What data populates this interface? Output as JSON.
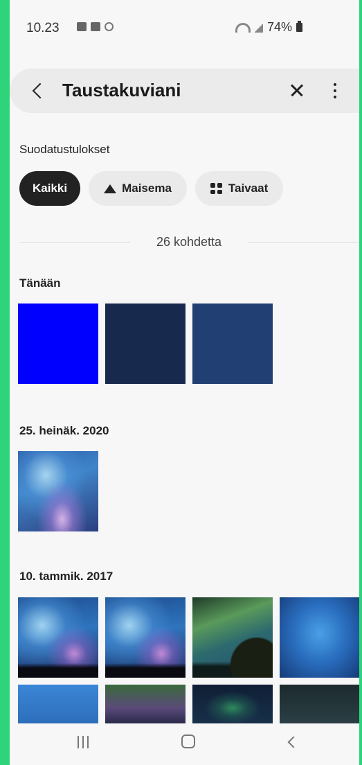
{
  "status_bar": {
    "time": "10.23",
    "battery": "74%"
  },
  "search": {
    "query": "Taustakuviani"
  },
  "filters": {
    "heading": "Suodatustulokset",
    "chips": [
      {
        "label": "Kaikki",
        "icon": ""
      },
      {
        "label": "Maisema",
        "icon": "landscape-icon"
      },
      {
        "label": "Taivaat",
        "icon": "grid-icon"
      }
    ]
  },
  "results_count": "26 kohdetta",
  "sections": [
    {
      "title": "Tänään",
      "thumbs": [
        "#0000ff",
        "#17294c",
        "#213f73"
      ]
    },
    {
      "title": "25. heinäk. 2020",
      "thumbs": [
        "aurora"
      ]
    },
    {
      "title": "10. tammik. 2017",
      "thumbs": [
        "aurora-trees",
        "aurora-trees",
        "green-aurora",
        "blue-gradient",
        "blue-light",
        "purple-haze",
        "dark-aurora",
        "dark-teal"
      ]
    }
  ],
  "navbar": {
    "icons": [
      "recents-icon",
      "home-icon",
      "back-icon"
    ]
  }
}
